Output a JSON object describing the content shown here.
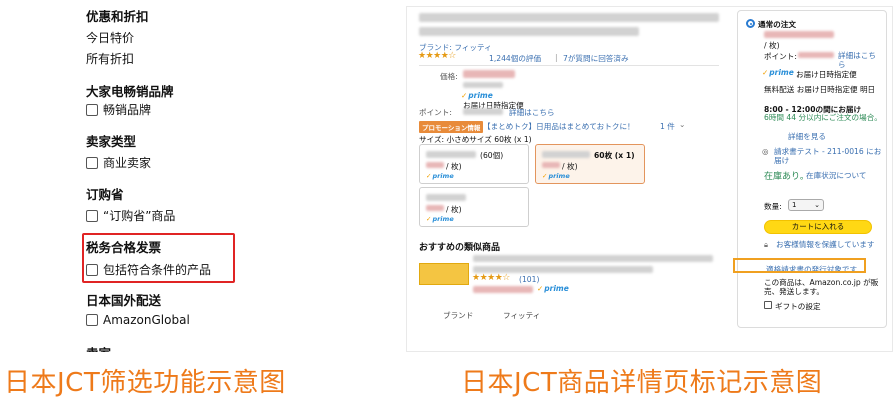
{
  "filter_panel": {
    "deals": {
      "heading": "优惠和折扣",
      "items": [
        "今日特价",
        "所有折扣"
      ]
    },
    "brands": {
      "heading": "大家电畅销品牌",
      "checkbox_label": "畅销品牌"
    },
    "seller_type": {
      "heading": "卖家类型",
      "checkbox_label": "商业卖家"
    },
    "subscribe": {
      "heading": "订购省",
      "checkbox_label": "“订购省”商品"
    },
    "tax_invoice": {
      "heading": "税务合格发票",
      "checkbox_label": "包括符合条件的产品"
    },
    "intl_shipping": {
      "heading": "日本国外配送",
      "checkbox_label": "AmazonGlobal"
    },
    "more_heading": "卖家"
  },
  "product_page": {
    "brand_line": "ブランド: フィッティ",
    "rating_count": "1,244個の評価",
    "answered": "7が質問に回答済み",
    "price_label": "価格:",
    "prime_delivery": "お届け日時指定便",
    "points_label": "ポイント:",
    "details_link": "詳細はこちら",
    "promo_tag": "プロモーション情報",
    "promo_text": "【まとめトク】日用品はまとめておトクに！",
    "promo_count": "1 件",
    "size_label": "サイズ: 小さめサイズ 60枚 (x 1)",
    "options": [
      {
        "title": "(60個)",
        "unit": "/ 枚)",
        "selected": false
      },
      {
        "title": "60枚 (x 1)",
        "unit": "/ 枚)",
        "selected": true
      },
      {
        "title": "",
        "unit": "/ 枚)",
        "selected": false
      }
    ],
    "similar_heading": "おすすめの類似商品",
    "similar_reviews": "(101)",
    "brand_col": "ブランド",
    "brand_val": "フィッティ"
  },
  "buy_box": {
    "title": "通常の注文",
    "unit": "/ 枚)",
    "points": "ポイント:",
    "details_link": "詳細はこちら",
    "prime_delivery": "お届け日時指定便",
    "free_ship": "無料配送 お届け日時指定便 明日",
    "time_slot": "8:00 - 12:00の間にお届け",
    "order_within": "6時間 44 分以内にご注文の場合。",
    "details_link2": "詳細を見る",
    "address": "請求書テスト - 211-0016 にお届け",
    "in_stock": "在庫あり。",
    "stock_note": "在庫状況について",
    "qty_label": "数量:",
    "qty_value": "1",
    "cart_button": "カートに入れる",
    "protect": "お客様情報を保護しています",
    "jct_badge": "適格請求書の発行対象です",
    "sold_by": "この商品は、Amazon.co.jp が販売、発送します。",
    "gift": "ギフトの設定"
  },
  "captions": {
    "left": "日本JCT筛选功能示意图",
    "right": "日本JCT商品详情页标记示意图"
  },
  "colors": {
    "highlight_red": "#e02424",
    "highlight_orange": "#f0a020",
    "caption_orange": "#ee7a1a",
    "cart_yellow": "#ffd814",
    "link_blue": "#3a6fb0",
    "in_stock_green": "#2e8b57"
  }
}
